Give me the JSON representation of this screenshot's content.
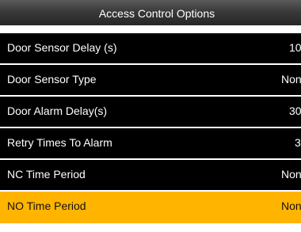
{
  "window": {
    "title": "Access Control Options"
  },
  "menu": {
    "items": [
      {
        "label": "Door Sensor Delay (s)",
        "value": "10"
      },
      {
        "label": "Door Sensor Type",
        "value": "None"
      },
      {
        "label": "Door Alarm Delay(s)",
        "value": "30"
      },
      {
        "label": "Retry Times To Alarm",
        "value": "3"
      },
      {
        "label": "NC Time Period",
        "value": "None"
      },
      {
        "label": "NO Time Period",
        "value": "None"
      }
    ]
  },
  "colors": {
    "selected_background": "#ffb400",
    "row_background": "#000000"
  }
}
